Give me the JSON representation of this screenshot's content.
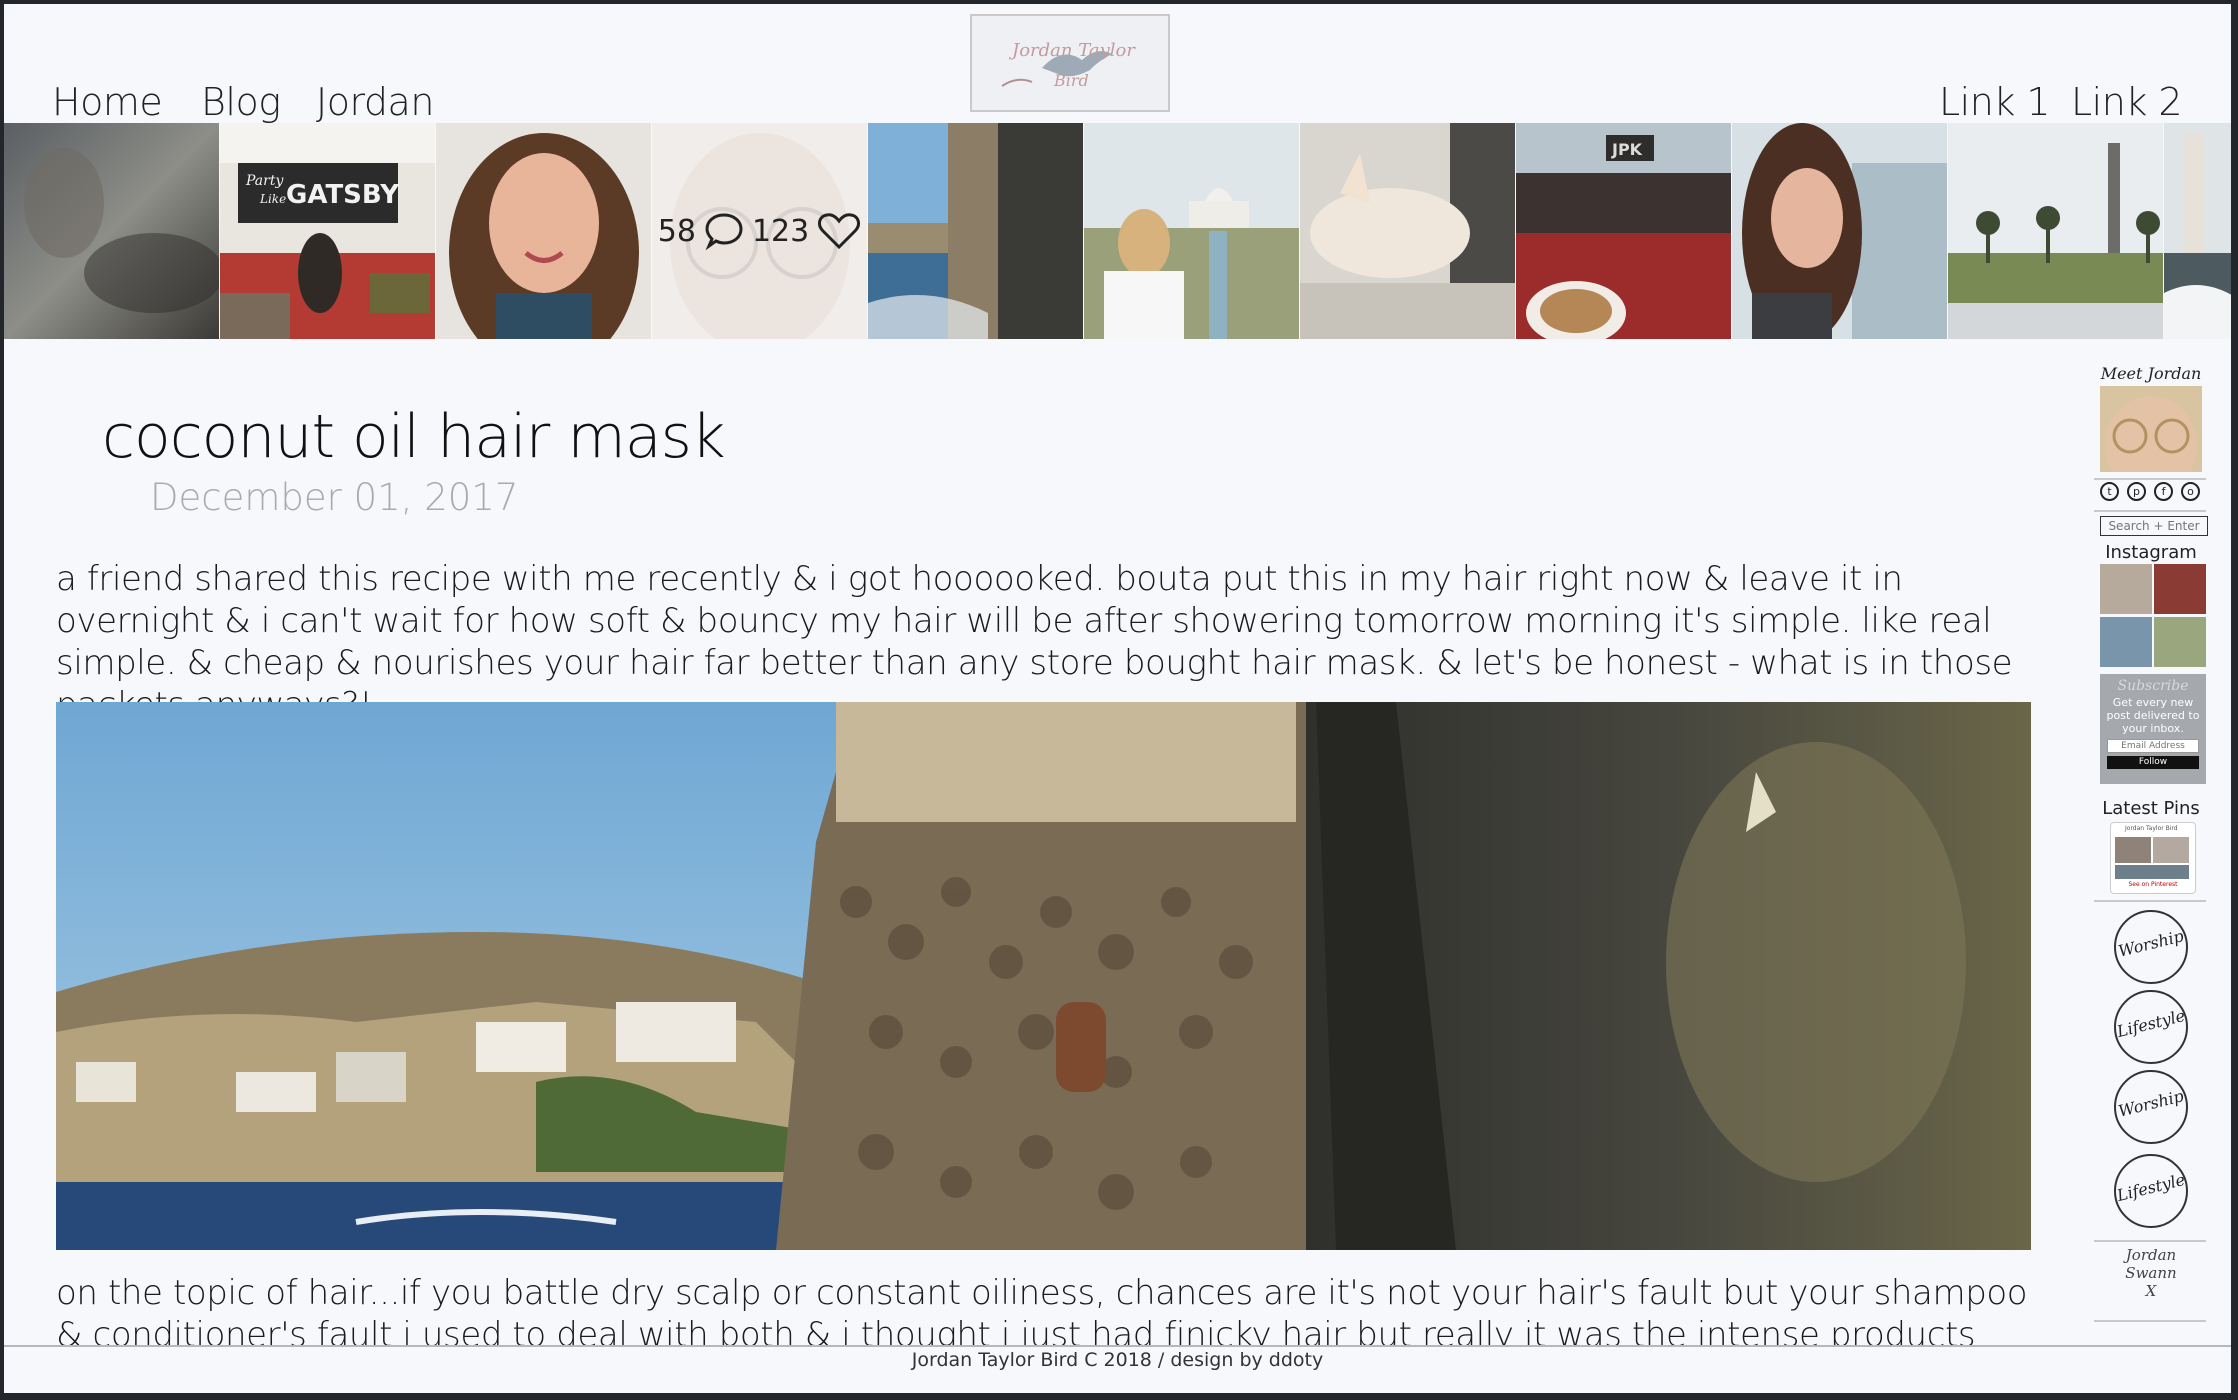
{
  "nav": {
    "left": [
      "Home",
      "Blog",
      "Jordan"
    ],
    "right": [
      "Link 1",
      "Link 2"
    ]
  },
  "logo": {
    "text_line1": "Jordan Taylor",
    "text_line2": "Bird"
  },
  "instagram_strip": {
    "tiles": [
      {
        "icon": "photo-rainy-window"
      },
      {
        "icon": "photo-party-gatsby",
        "sign_line1": "Party",
        "sign_line2": "Like",
        "sign_word": "GATSBY"
      },
      {
        "icon": "photo-portrait-woman"
      },
      {
        "icon": "photo-face-glasses",
        "comments": "58",
        "likes": "123"
      },
      {
        "icon": "photo-coast-tower"
      },
      {
        "icon": "photo-taj-mahal"
      },
      {
        "icon": "photo-sleeping-chihuahua"
      },
      {
        "icon": "photo-cafe-coffee",
        "sign_word": "JPK"
      },
      {
        "icon": "photo-woman-profile"
      },
      {
        "icon": "photo-palm-park"
      },
      {
        "icon": "photo-lighthouse"
      }
    ]
  },
  "post": {
    "title": "coconut oil hair mask",
    "date": "December 01, 2017",
    "paragraph1": "a friend shared this recipe with me recently & i got hoooooked. bouta put this in my hair right now & leave it in overnight & i can't wait for how soft & bouncy my hair will be after showering tomorrow morning it's simple. like real simple. & cheap & nourishes your hair far better than any store bought hair mask. & let's be honest - what is in those packets anyways?!",
    "hero_image": "photo-stone-tower-coast",
    "paragraph2": "on the topic of hair...if you battle dry scalp or constant oiliness, chances are it's not your hair's fault but your shampoo & conditioner's fault i used to deal with both & i thought i just had finicky hair but really it was the intense products stripping my"
  },
  "sidebar": {
    "meet_label": "Meet Jordan",
    "social_icons": [
      "twitter-icon",
      "pinterest-icon",
      "facebook-icon",
      "instagram-icon"
    ],
    "search_placeholder": "Search + Enter",
    "instagram_label": "Instagram",
    "subscribe": {
      "title": "Subscribe",
      "text": "Get every new post delivered to your inbox.",
      "email_placeholder": "Email Address",
      "button": "Follow"
    },
    "latest_pins_label": "Latest Pins",
    "pins_widget": {
      "name": "Jordan Taylor Bird",
      "link": "See on Pinterest"
    },
    "badges": [
      "Worship",
      "Lifestyle",
      "Worship",
      "Lifestyle"
    ],
    "signature": [
      "Jordan",
      "Swann",
      "X"
    ]
  },
  "footer": {
    "text": "Jordan Taylor Bird C 2018 / design by ddoty"
  }
}
